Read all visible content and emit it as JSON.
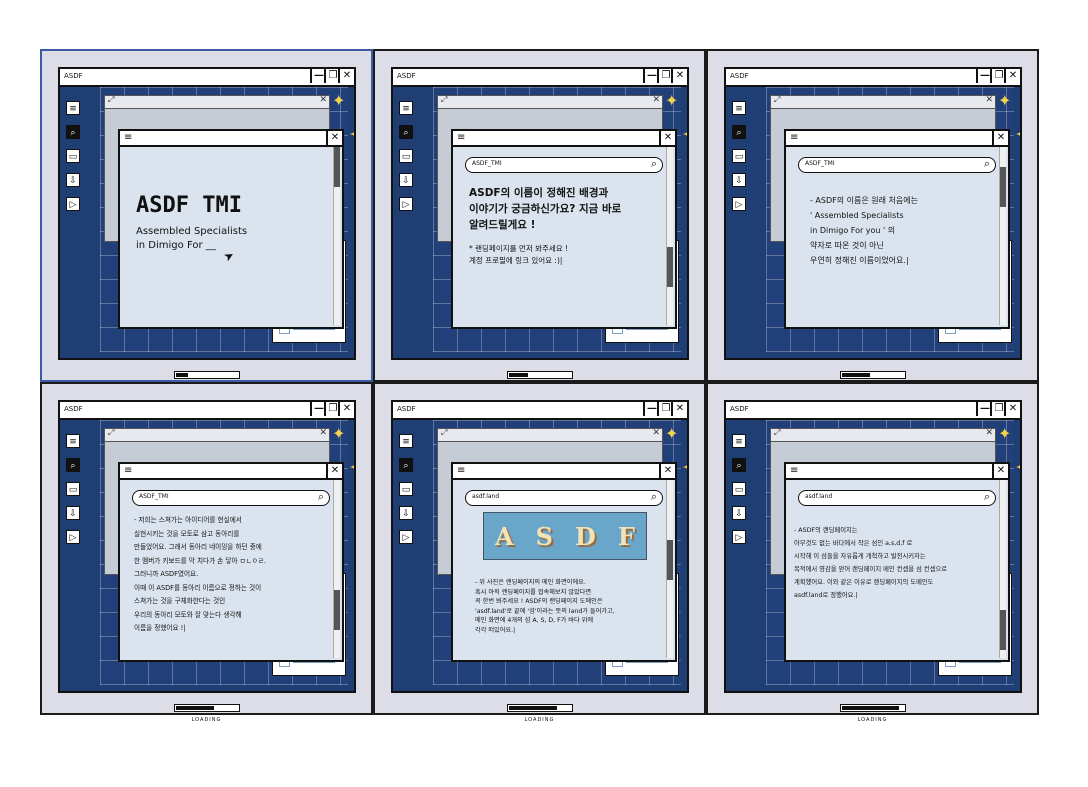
{
  "app": {
    "window_title": "ASDF",
    "minimize": "—",
    "restore": "❐",
    "close": "✕"
  },
  "icons": {
    "hamburger": "≡",
    "search": "⌕",
    "folder": "▭",
    "download": "⇩",
    "play": "▷",
    "expand": "⤢",
    "check": "☑",
    "star": "✦"
  },
  "loading_label": "LOADING",
  "panels": [
    {
      "search": "",
      "title": "ASDF TMI",
      "subtitle": "Assembled Specialists\nin Dimigo For __",
      "text": "",
      "progress": 0.2
    },
    {
      "search": "ASDF_TMI",
      "title": "ASDF의 이름이 정해진 배경과\n이야기가 궁금하신가요? 지금 바로\n알려드릴게요 !",
      "text": "* 랜딩페이지를 먼저 봐주세요 !\n  계정 프로필에 링크 있어요 :)|",
      "progress": 0.3
    },
    {
      "search": "ASDF_TMI",
      "title": "",
      "text": "- ASDF의 이름은 원래 처음에는\n' Assembled Specialists\n  in Dimigo For you ' 의\n약자로 따온 것이 아닌\n우연히 정해진 이름이었어요.|",
      "progress": 0.45
    },
    {
      "search": "ASDF_TMI",
      "title": "",
      "text": "- 저희는 스쳐가는 아이디어를 현실에서\n실현시키는 것을 모토로 삼고 동아리를\n만들었어요. 그래서 동아리 네이밍을 하던 중에\n한 멤버가 키보드를 막 치다가 손 닿아 ㅁㄴㅇㄹ.\n그러니까 ASDF였어요.\n이때 이 ASDF를 동아리 이름으로 정하는 것이\n스쳐가는 것을 구체화한다는 것인\n우리의 동아리 모토와 잘 맞는다 생각해\n이름을 정했어요 !|",
      "progress": 0.6
    },
    {
      "search": "asdf.land",
      "title": "",
      "logo_letters": [
        "A",
        "S",
        "D",
        "F"
      ],
      "text": "- 위 사진은 랜딩페이지의 메인 화면이에요.\n혹시 아직 랜딩페이지를 접속해보지 않았다면\n꼭 한번 봐주세요 ! ASDF의 랜딩페이지 도메인은\n'asdf.land'로 끝에 '섬'이라는 뜻의 land가 들어가고,\n메인 화면에 4개의 섬 A, S, D, F가 바다 위에\n각각 떠있어요.|",
      "progress": 0.75
    },
    {
      "search": "asdf.land",
      "title": "",
      "text": "- ASDF의 랜딩페이지는\n아무것도 없는 바다에서 작은 섬인 a,s,d,f 로\n시작해 이 섬들을 자유롭게 개척하고 발전시키자는\n목적에서 영감을 얻어 랜딩페이지 메인 컨셉을 섬 컨셉으로\n계획했어요. 이와 같은 이유로 랜딩페이지의 도메인도\nasdf.land로 정했어요.|",
      "progress": 0.9
    }
  ]
}
